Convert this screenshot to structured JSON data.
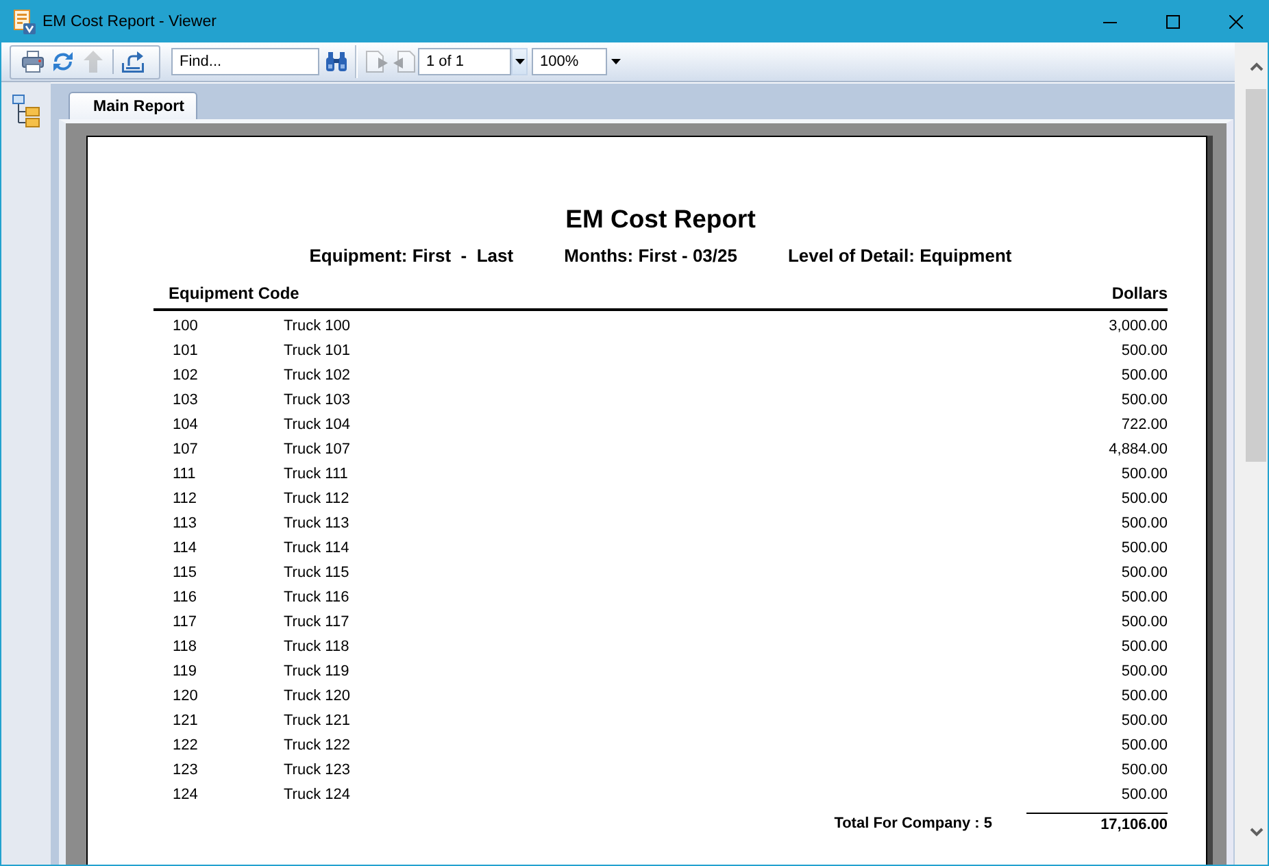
{
  "window": {
    "title": "EM Cost Report - Viewer"
  },
  "toolbar": {
    "buttons": [
      {
        "kind": "print",
        "disabled": false
      },
      {
        "kind": "refresh",
        "disabled": false
      },
      {
        "kind": "up",
        "disabled": true
      },
      {
        "kind": "export",
        "disabled": false
      }
    ],
    "find": {
      "placeholder": "Find..."
    },
    "page_buttons": [
      {
        "kind": "forward",
        "disabled": true
      },
      {
        "kind": "back",
        "disabled": true
      }
    ],
    "page": {
      "value": "1 of 1",
      "highlighted": true
    },
    "zoom": {
      "value": "100%",
      "highlighted": false
    }
  },
  "tabs": [
    {
      "label": "Main Report",
      "selected": true
    }
  ],
  "report": {
    "title": "EM Cost Report",
    "parameters": [
      "Equipment: First  -  Last",
      "Months: First - 03/25",
      "Level of Detail: Equipment"
    ],
    "columns": [
      "Equipment Code",
      "Dollars"
    ],
    "rows": [
      {
        "code": "100",
        "description": "Truck 100",
        "dollars": "3,000.00"
      },
      {
        "code": "101",
        "description": "Truck 101",
        "dollars": "500.00"
      },
      {
        "code": "102",
        "description": "Truck 102",
        "dollars": "500.00"
      },
      {
        "code": "103",
        "description": "Truck 103",
        "dollars": "500.00"
      },
      {
        "code": "104",
        "description": "Truck 104",
        "dollars": "722.00"
      },
      {
        "code": "107",
        "description": "Truck 107",
        "dollars": "4,884.00"
      },
      {
        "code": "111",
        "description": "Truck 111",
        "dollars": "500.00"
      },
      {
        "code": "112",
        "description": "Truck 112",
        "dollars": "500.00"
      },
      {
        "code": "113",
        "description": "Truck 113",
        "dollars": "500.00"
      },
      {
        "code": "114",
        "description": "Truck 114",
        "dollars": "500.00"
      },
      {
        "code": "115",
        "description": "Truck 115",
        "dollars": "500.00"
      },
      {
        "code": "116",
        "description": "Truck 116",
        "dollars": "500.00"
      },
      {
        "code": "117",
        "description": "Truck 117",
        "dollars": "500.00"
      },
      {
        "code": "118",
        "description": "Truck 118",
        "dollars": "500.00"
      },
      {
        "code": "119",
        "description": "Truck 119",
        "dollars": "500.00"
      },
      {
        "code": "120",
        "description": "Truck 120",
        "dollars": "500.00"
      },
      {
        "code": "121",
        "description": "Truck 121",
        "dollars": "500.00"
      },
      {
        "code": "122",
        "description": "Truck 122",
        "dollars": "500.00"
      },
      {
        "code": "123",
        "description": "Truck 123",
        "dollars": "500.00"
      },
      {
        "code": "124",
        "description": "Truck 124",
        "dollars": "500.00"
      }
    ],
    "total": {
      "label": "Total For Company : 5",
      "value": "17,106.00"
    }
  }
}
